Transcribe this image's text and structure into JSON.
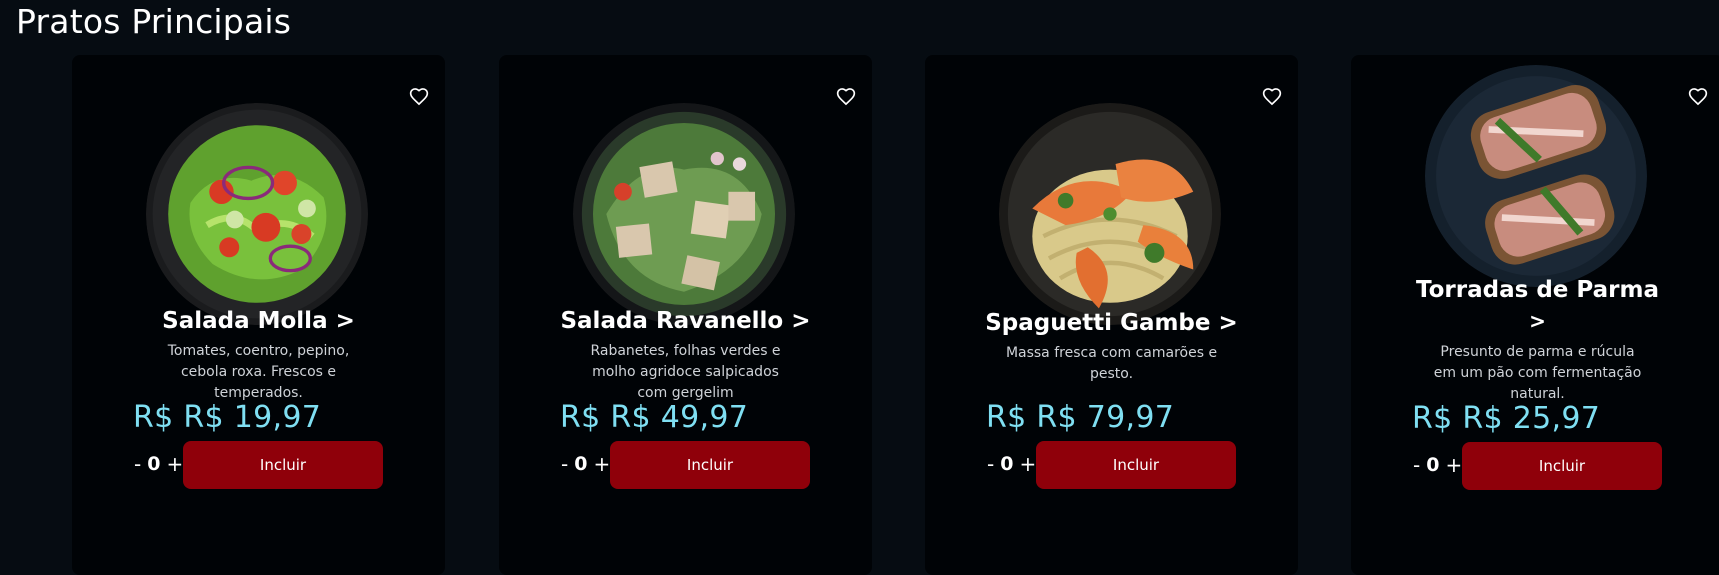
{
  "section": {
    "title": "Pratos Principais"
  },
  "colors": {
    "price": "#7fdff2",
    "button": "#8f000a",
    "card": "#000306",
    "page": "#060c12"
  },
  "products": [
    {
      "name": "Salada Molla >",
      "description": "Tomates, coentro, pepino, cebola roxa. Frescos e temperados.",
      "price": "R$ R$ 19,97",
      "quantity": "0",
      "add_label": "Incluir",
      "minus": "-",
      "plus": "+",
      "favorite_icon": "heart-outline-icon",
      "image": "salad-bowl-tomato-onion"
    },
    {
      "name": "Salada Ravanello >",
      "description": "Rabanetes, folhas verdes e molho agridoce salpicados com gergelim",
      "price": "R$ R$ 49,97",
      "quantity": "0",
      "add_label": "Incluir",
      "minus": "-",
      "plus": "+",
      "favorite_icon": "heart-outline-icon",
      "image": "salad-bowl-radish-cheese"
    },
    {
      "name": "Spaguetti Gambe >",
      "description": "Massa fresca com camarões e pesto.",
      "price": "R$ R$ 79,97",
      "quantity": "0",
      "add_label": "Incluir",
      "minus": "-",
      "plus": "+",
      "favorite_icon": "heart-outline-icon",
      "image": "spaghetti-shrimp-plate"
    },
    {
      "name": "Torradas de Parma",
      "name_arrow": ">",
      "description": "Presunto de parma e rúcula em um pão com fermentação natural.",
      "price": "R$ R$ 25,97",
      "quantity": "0",
      "add_label": "Incluir",
      "minus": "-",
      "plus": "+",
      "favorite_icon": "heart-outline-icon",
      "image": "parma-toast-plate"
    }
  ]
}
